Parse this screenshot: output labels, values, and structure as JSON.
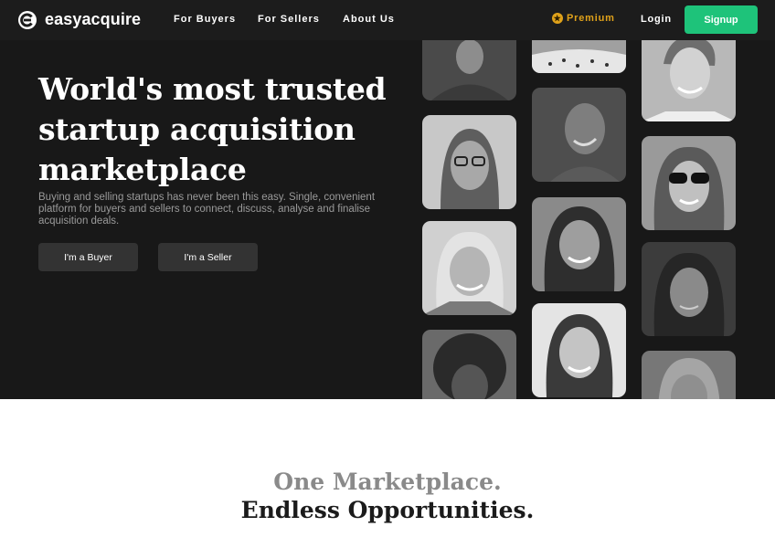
{
  "brand": {
    "name": "easyacquire"
  },
  "nav": {
    "links": [
      "For Buyers",
      "For Sellers",
      "About Us"
    ],
    "premium": "Premium",
    "login": "Login",
    "signup": "Signup"
  },
  "hero": {
    "headline_lines": [
      "World's most trusted",
      "startup acquisition",
      "marketplace"
    ],
    "subtext": "Buying and selling startups has never been this easy. Single, convenient platform for buyers and sellers to connect, discuss, analyse and finalise acquisition deals.",
    "buttons": [
      "I'm a Buyer",
      "I'm a Seller"
    ]
  },
  "section": {
    "tagline_1": "One Marketplace.",
    "tagline_2": "Endless Opportunities."
  },
  "colors": {
    "accent": "#1ec37a",
    "premium": "#e0a21a",
    "hero_bg": "#181818"
  }
}
